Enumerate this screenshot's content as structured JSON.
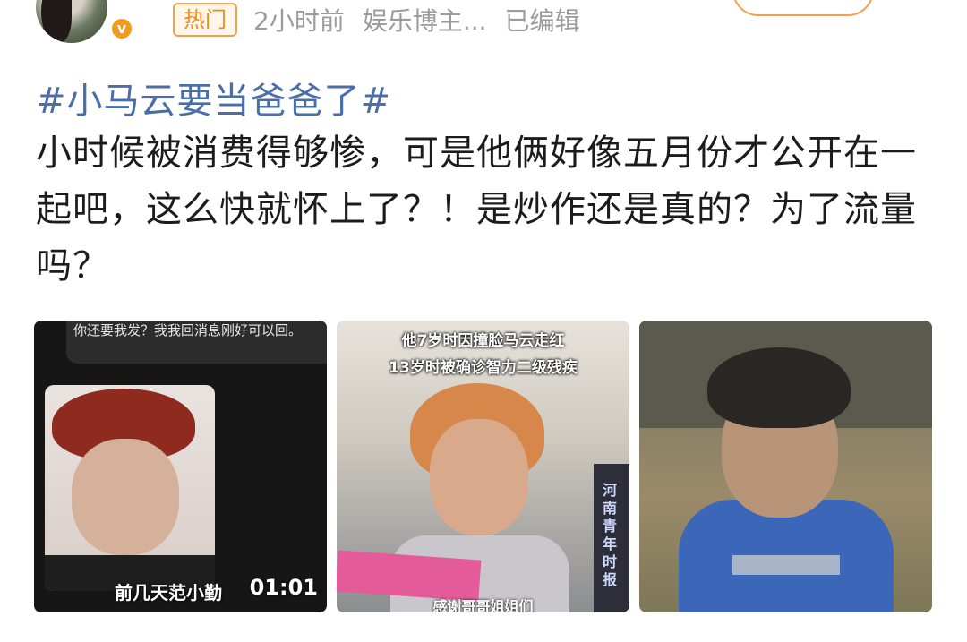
{
  "post": {
    "hot_badge": "热门",
    "time": "2小时前",
    "author_tag": "娱乐博主...",
    "edited": "已编辑",
    "verify_mark": "v",
    "hashtag": "#小马云要当爸爸了#",
    "text": "小时候被消费得够惨，可是他俩好像五月份才公开在一起吧，这么快就怀上了？！是炒作还是真的？为了流量吗？"
  },
  "images": [
    {
      "chat_text": "你还要我发？我我回消息刚好可以回。",
      "caption": "前几天范小勤",
      "duration": "01:01"
    },
    {
      "caption_top_1": "他7岁时因撞脸马云走红",
      "caption_top_2": "13岁时被确诊智力二级残疾",
      "side_text": "河南青年时报",
      "caption_bottom": "感谢哥哥姐姐们"
    },
    {}
  ]
}
